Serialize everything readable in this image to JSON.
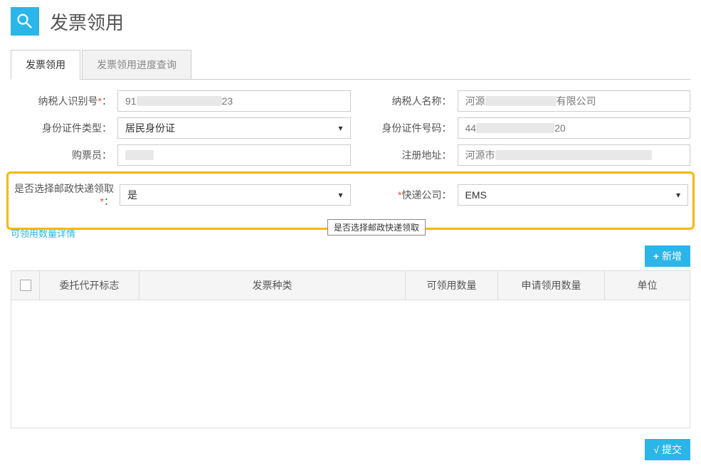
{
  "header": {
    "title": "发票领用"
  },
  "tabs": [
    {
      "label": "发票领用",
      "active": true
    },
    {
      "label": "发票领用进度查询",
      "active": false
    }
  ],
  "form": {
    "taxpayer_id_label": "纳税人识别号",
    "taxpayer_id_prefix": "91",
    "taxpayer_id_suffix": "23",
    "taxpayer_name_label": "纳税人名称：",
    "taxpayer_name_prefix": "河源",
    "taxpayer_name_suffix": "有限公司",
    "id_type_label": "身份证件类型：",
    "id_type_value": "居民身份证",
    "id_number_label": "身份证件号码：",
    "id_number_prefix": "44",
    "id_number_suffix": "20",
    "buyer_label": "购票员：",
    "buyer_value": "",
    "address_label": "注册地址：",
    "address_prefix": "河源市",
    "postal_label": "是否选择邮政快递领取",
    "postal_value": "是",
    "express_label": "快递公司：",
    "express_value": "EMS"
  },
  "tooltip": "是否选择邮政快递领取",
  "link": "可领用数量详情",
  "toolbar": {
    "add": "新增"
  },
  "table": {
    "headers": {
      "flag": "委托代开标志",
      "type": "发票种类",
      "available": "可领用数量",
      "apply": "申请领用数量",
      "unit": "单位"
    }
  },
  "footer": {
    "submit": "提交"
  }
}
